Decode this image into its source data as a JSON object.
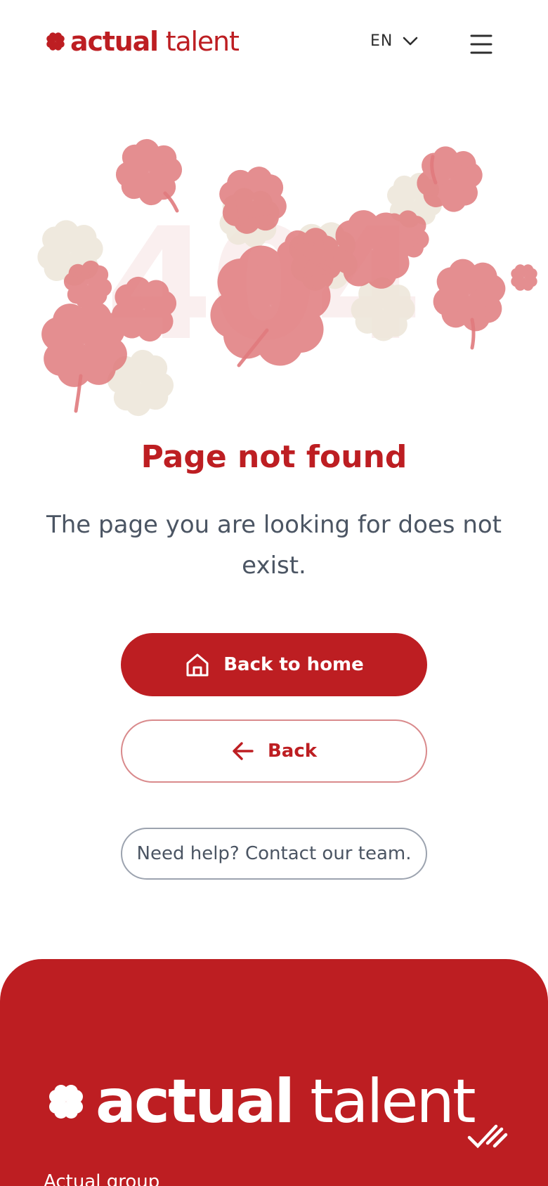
{
  "header": {
    "logo_bold": "actual",
    "logo_light": " talent",
    "language": "EN",
    "icons": {
      "logo": "clover-icon",
      "language_toggle": "chevron-down-icon",
      "menu": "hamburger-menu-icon"
    }
  },
  "hero": {
    "background_code": "404",
    "illustration": "clover-cluster"
  },
  "content": {
    "title": "Page not found",
    "message": "The page you are looking for does not exist."
  },
  "actions": {
    "home_label": "Back to home",
    "home_icon": "home-icon",
    "back_label": "Back",
    "back_icon": "arrow-left-icon",
    "help_label": "Need help? Contact our team."
  },
  "footer": {
    "logo_bold": "actual",
    "logo_light": " talent",
    "badge_icon": "checkmark-stripes-icon",
    "group_label": "Actual group"
  },
  "colors": {
    "brand_red": "#bd1e22",
    "clover_pink": "#e07a7d",
    "clover_beige": "#ece6d8",
    "text_gray": "#4b5563"
  }
}
